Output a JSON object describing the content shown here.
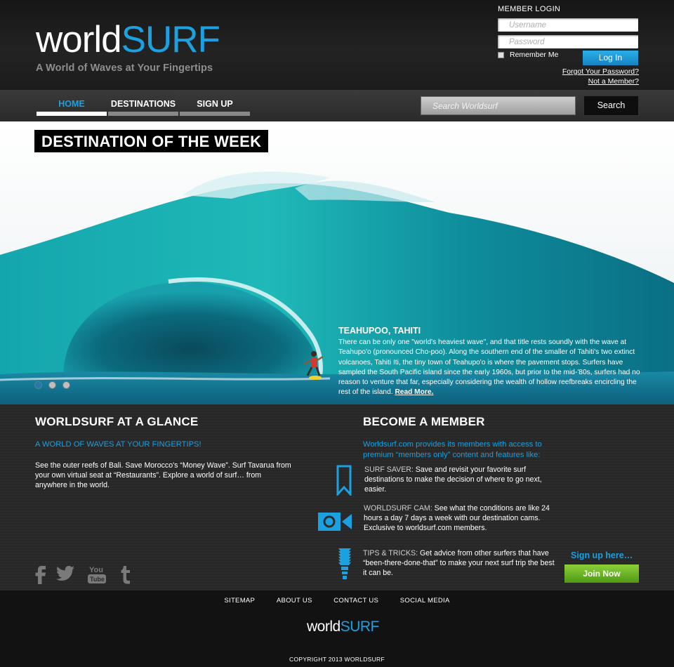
{
  "header": {
    "logo_world": "world",
    "logo_surf": "SURF",
    "tagline": "A World of Waves at Your Fingertips"
  },
  "login": {
    "title": "MEMBER LOGIN",
    "username_placeholder": "Username",
    "password_placeholder": "Password",
    "remember_label": "Remember Me",
    "button_label": "Log In",
    "forgot_link": "Forgot Your Password?",
    "not_member_link": "Not a Member?"
  },
  "nav": {
    "items": [
      {
        "label": "HOME",
        "active": true
      },
      {
        "label": "DESTINATIONS",
        "active": false
      },
      {
        "label": "SIGN UP",
        "active": false
      }
    ],
    "search_placeholder": "Search Worldsurf",
    "search_button": "Search"
  },
  "hero": {
    "badge": "DESTINATION OF THE WEEK",
    "title": "TEAHUPOO, TAHITI",
    "body": "There can be only one \"world's heaviest wave\", and that title rests soundly with the wave at Teahupo'o (pronounced Cho-poo). Along the southern end of the smaller of Tahiti's two extinct volcanoes, Tahiti Iti, the tiny town of Teahupo'o is where the pavement stops. Surfers have sampled the South Pacific island since the early 1960s, but prior to the mid-'80s, surfers had no reason to venture that far, especially considering the wealth of hollow reefbreaks encircling the rest of the island.",
    "read_more": "Read More."
  },
  "glance": {
    "title": "WORLDSURF AT A GLANCE",
    "subtitle": "A WORLD OF WAVES AT YOUR FINGERTIPS!",
    "body": "See the outer reefs of Bali. Save Morocco's “Money Wave”. Surf Tavarua from your own virtual seat at “Restaurants”. Explore a world of surf… from anywhere in the world."
  },
  "member": {
    "title": "BECOME A MEMBER",
    "intro": "Worldsurf.com provides its members with access to premium “members only” content and features like:",
    "features": [
      {
        "key": "SURF SAVER:",
        "text": " Save and revisit your favorite surf destinations to make the decision of where to go next, easier."
      },
      {
        "key": "WORLDSURF CAM:",
        "text": " See what the conditions are like 24 hours a day 7 days a week with our destination cams. Exclusive to worldsurf.com members."
      },
      {
        "key": "TIPS & TRICKS:",
        "text": " Get advice from other surfers that have “been-there-done-that” to make your next surf trip the best it can be."
      }
    ],
    "signup_here": "Sign up here…",
    "join_button": "Join Now"
  },
  "footer": {
    "links": [
      "SITEMAP",
      "ABOUT US",
      "CONTACT US",
      "SOCIAL MEDIA"
    ],
    "logo_world": "world",
    "logo_surf": "SURF",
    "copyright": "COPYRIGHT 2013 WORLDSURF"
  },
  "colors": {
    "accent": "#1ba0e0",
    "join_green": "#6cb524"
  },
  "icons": [
    "facebook-icon",
    "twitter-icon",
    "youtube-icon",
    "tumblr-icon",
    "bookmark-icon",
    "camera-icon",
    "lightbulb-icon"
  ]
}
